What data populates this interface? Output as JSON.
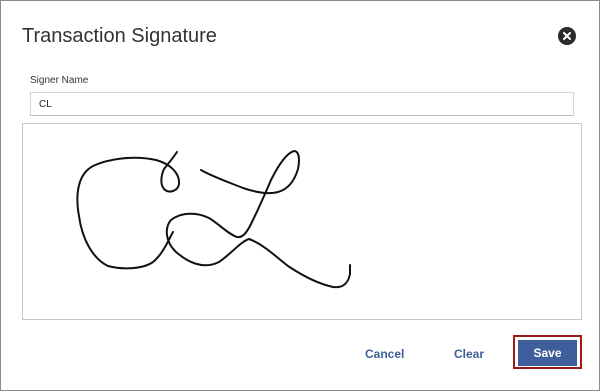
{
  "dialog": {
    "title": "Transaction Signature",
    "close_icon": "close-circle-icon"
  },
  "signer": {
    "label": "Signer Name",
    "value": "CL"
  },
  "signature_pad": {
    "stroke_color": "#111111"
  },
  "actions": {
    "cancel_label": "Cancel",
    "clear_label": "Clear",
    "save_label": "Save"
  },
  "colors": {
    "primary": "#3f5e9c",
    "focus_outline": "#9b1b1b"
  }
}
